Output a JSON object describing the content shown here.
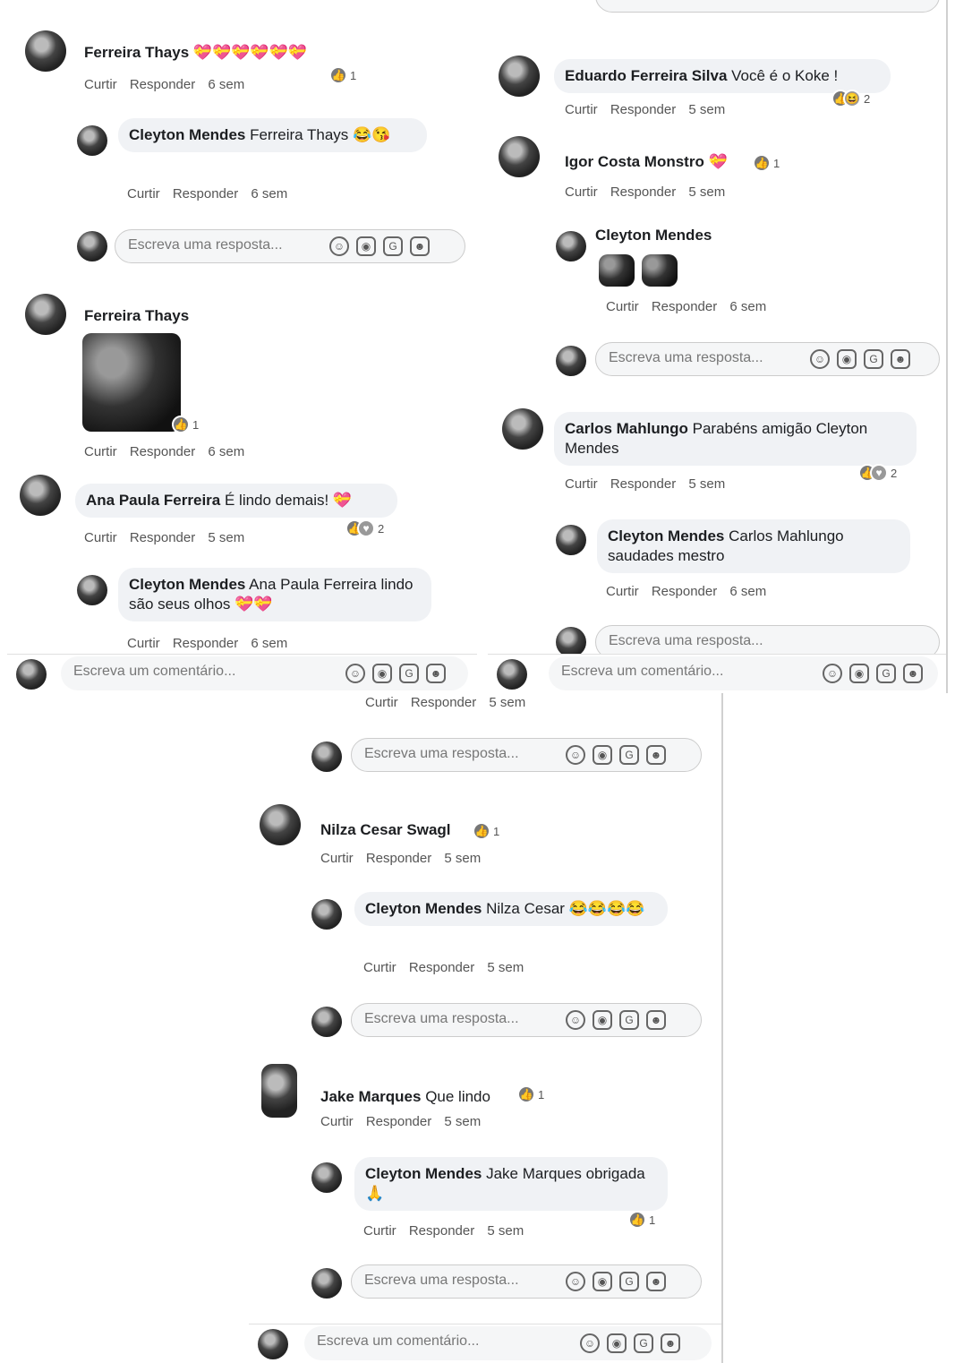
{
  "common": {
    "like": "Curtir",
    "reply": "Responder",
    "reply_placeholder": "Escreva uma resposta...",
    "comment_placeholder": "Escreva um comentário..."
  },
  "panel1": {
    "c1": {
      "author": "Ferreira Thays",
      "text": "💝💝💝💝💝💝",
      "time": "6 sem",
      "reactions": "1"
    },
    "c1r": {
      "author": "Cleyton Mendes",
      "text": "Ferreira Thays 😂😘",
      "time": "6 sem"
    },
    "c2": {
      "author": "Ferreira Thays",
      "time": "6 sem",
      "reactions": "1"
    },
    "c3": {
      "author": "Ana Paula Ferreira",
      "text": "É lindo demais! 💝",
      "time": "5 sem",
      "reactions": "2"
    },
    "c3r": {
      "author": "Cleyton Mendes",
      "text": "Ana Paula Ferreira lindo são seus olhos 💝💝",
      "time": "6 sem"
    }
  },
  "panel2": {
    "c1": {
      "author": "Eduardo Ferreira Silva",
      "text": "Você é o Koke !",
      "time": "5 sem",
      "reactions": "2"
    },
    "c2": {
      "author": "Igor Costa Monstro",
      "text": "💝",
      "time": "5 sem",
      "reactions": "1"
    },
    "c2r": {
      "author": "Cleyton Mendes",
      "time": "6 sem"
    },
    "c3": {
      "author": "Carlos Mahlungo",
      "text": "Parabéns amigão Cleyton Mendes",
      "time": "5 sem",
      "reactions": "2"
    },
    "c3r": {
      "author": "Cleyton Mendes",
      "text": "Carlos Mahlungo saudades mestro",
      "time": "6 sem"
    }
  },
  "panel3": {
    "top_meta_time": "5 sem",
    "c1": {
      "author": "Nilza Cesar Swagl",
      "time": "5 sem",
      "reactions": "1"
    },
    "c1r": {
      "author": "Cleyton Mendes",
      "text": "Nilza Cesar 😂😂😂😂",
      "time": "5 sem"
    },
    "c2": {
      "author": "Jake Marques",
      "text": "Que lindo",
      "time": "5 sem",
      "reactions": "1"
    },
    "c2r": {
      "author": "Cleyton Mendes",
      "text": "Jake Marques obrigada 🙏",
      "time": "5 sem",
      "reactions": "1"
    }
  }
}
